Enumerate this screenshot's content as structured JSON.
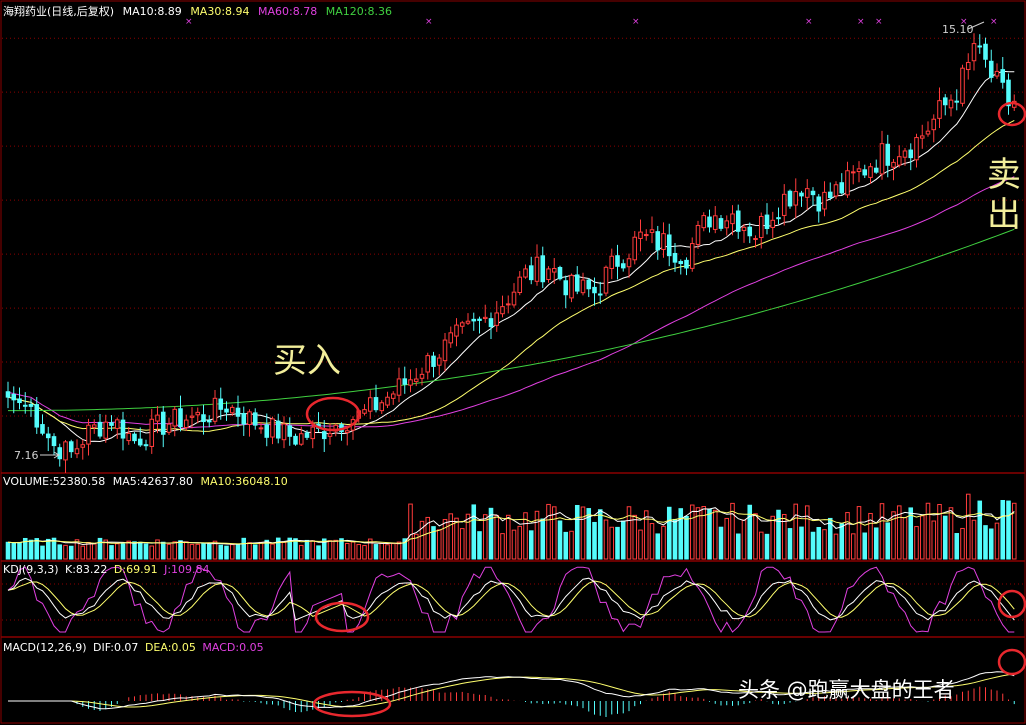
{
  "main_header": {
    "title": "海翔药业(日线,后复权)",
    "ma10": "MA10:8.89",
    "ma30": "MA30:8.94",
    "ma60": "MA60:8.78",
    "ma120": "MA120:8.36"
  },
  "price_labels": {
    "high": "15.10",
    "low": "7.16"
  },
  "annotations": {
    "buy": "买入",
    "sell_top": "卖",
    "sell_bottom": "出"
  },
  "volume_header": {
    "volume": "VOLUME:52380.58",
    "ma5": "MA5:42637.80",
    "ma10": "MA10:36048.10"
  },
  "kdj_header": {
    "name": "KDJ(9,3,3)",
    "k": "K:83.22",
    "d": "D:69.91",
    "j": "J:109.84"
  },
  "macd_header": {
    "name": "MACD(12,26,9)",
    "dif": "DIF:0.07",
    "dea": "DEA:0.05",
    "macd": "MACD:0.05"
  },
  "watermark": "头条 @跑赢大盘的王者",
  "colors": {
    "up": "#FF3C3C",
    "down": "#54FCFC",
    "ma10": "#FFFFFF",
    "ma30": "#FFFF6E",
    "ma60": "#E040E0",
    "ma120": "#40D040",
    "grid": "#8B0000",
    "annotation": "#F2EE9A",
    "circle": "#E8282E"
  },
  "chart_data": {
    "type": "candlestick",
    "title": "海翔药业(日线,后复权)",
    "price_range": [
      7.0,
      15.3
    ],
    "high_marker": 15.1,
    "low_marker": 7.16,
    "anchors": [
      {
        "i": 0,
        "p": 8.35
      },
      {
        "i": 4,
        "p": 8.15
      },
      {
        "i": 8,
        "p": 7.45
      },
      {
        "i": 11,
        "p": 7.3
      },
      {
        "i": 14,
        "p": 7.7
      },
      {
        "i": 18,
        "p": 7.95
      },
      {
        "i": 22,
        "p": 7.55
      },
      {
        "i": 26,
        "p": 7.8
      },
      {
        "i": 30,
        "p": 7.95
      },
      {
        "i": 34,
        "p": 8.0
      },
      {
        "i": 38,
        "p": 8.2
      },
      {
        "i": 42,
        "p": 7.95
      },
      {
        "i": 46,
        "p": 7.75
      },
      {
        "i": 50,
        "p": 7.6
      },
      {
        "i": 54,
        "p": 7.7
      },
      {
        "i": 58,
        "p": 7.9
      },
      {
        "i": 62,
        "p": 8.05
      },
      {
        "i": 66,
        "p": 8.35
      },
      {
        "i": 70,
        "p": 8.7
      },
      {
        "i": 74,
        "p": 9.1
      },
      {
        "i": 78,
        "p": 9.45
      },
      {
        "i": 82,
        "p": 9.7
      },
      {
        "i": 86,
        "p": 10.1
      },
      {
        "i": 90,
        "p": 10.6
      },
      {
        "i": 94,
        "p": 10.8
      },
      {
        "i": 98,
        "p": 10.35
      },
      {
        "i": 102,
        "p": 10.3
      },
      {
        "i": 106,
        "p": 10.9
      },
      {
        "i": 110,
        "p": 11.3
      },
      {
        "i": 114,
        "p": 11.2
      },
      {
        "i": 118,
        "p": 11.0
      },
      {
        "i": 122,
        "p": 11.7
      },
      {
        "i": 126,
        "p": 11.75
      },
      {
        "i": 130,
        "p": 11.4
      },
      {
        "i": 134,
        "p": 11.95
      },
      {
        "i": 138,
        "p": 12.3
      },
      {
        "i": 142,
        "p": 12.0
      },
      {
        "i": 146,
        "p": 12.3
      },
      {
        "i": 150,
        "p": 12.7
      },
      {
        "i": 154,
        "p": 12.95
      },
      {
        "i": 158,
        "p": 13.1
      },
      {
        "i": 162,
        "p": 13.6
      },
      {
        "i": 166,
        "p": 14.2
      },
      {
        "i": 168,
        "p": 14.7
      },
      {
        "i": 170,
        "p": 14.5
      },
      {
        "i": 172,
        "p": 14.1
      },
      {
        "i": 174,
        "p": 13.8
      }
    ],
    "annotations": [
      {
        "text": "买入",
        "at": "buy-circle near bar 55"
      },
      {
        "text": "卖出",
        "at": "sell-circle at last bar"
      }
    ]
  }
}
